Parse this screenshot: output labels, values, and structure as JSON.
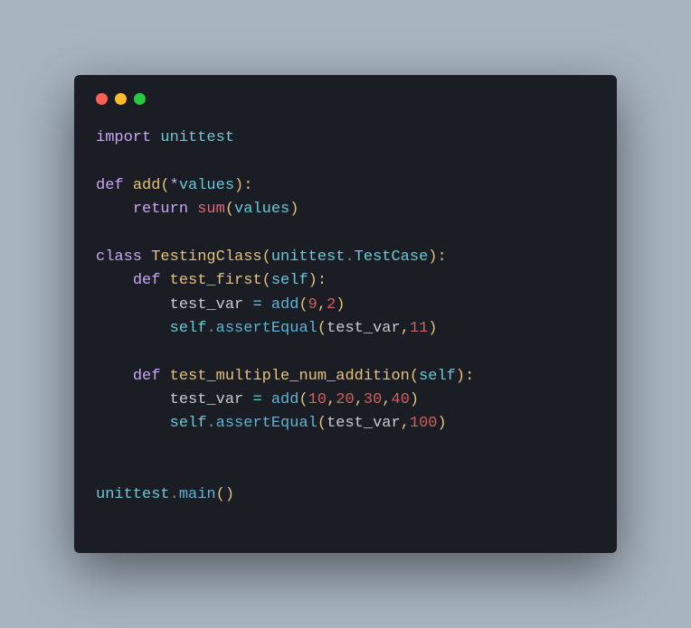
{
  "window": {
    "controls": [
      "close",
      "minimize",
      "zoom"
    ]
  },
  "code": {
    "lines": [
      [
        {
          "t": "import ",
          "c": "kw"
        },
        {
          "t": "unittest",
          "c": "mod"
        }
      ],
      [],
      [
        {
          "t": "def ",
          "c": "kw"
        },
        {
          "t": "add",
          "c": "fnname"
        },
        {
          "t": "(",
          "c": "punct"
        },
        {
          "t": "*",
          "c": "kw"
        },
        {
          "t": "values",
          "c": "param"
        },
        {
          "t": "):",
          "c": "punct"
        }
      ],
      [
        {
          "t": "    ",
          "c": ""
        },
        {
          "t": "return ",
          "c": "kw"
        },
        {
          "t": "sum",
          "c": "builtin"
        },
        {
          "t": "(",
          "c": "punct"
        },
        {
          "t": "values",
          "c": "param"
        },
        {
          "t": ")",
          "c": "punct"
        }
      ],
      [],
      [
        {
          "t": "class ",
          "c": "kw"
        },
        {
          "t": "TestingClass",
          "c": "fnname"
        },
        {
          "t": "(",
          "c": "punct"
        },
        {
          "t": "unittest",
          "c": "mod"
        },
        {
          "t": ".",
          "c": "dot2"
        },
        {
          "t": "TestCase",
          "c": "mod"
        },
        {
          "t": "):",
          "c": "punct"
        }
      ],
      [
        {
          "t": "    ",
          "c": ""
        },
        {
          "t": "def ",
          "c": "kw"
        },
        {
          "t": "test_first",
          "c": "fnname"
        },
        {
          "t": "(",
          "c": "punct"
        },
        {
          "t": "self",
          "c": "param"
        },
        {
          "t": "):",
          "c": "punct"
        }
      ],
      [
        {
          "t": "        ",
          "c": ""
        },
        {
          "t": "test_var",
          "c": "id"
        },
        {
          "t": " = ",
          "c": "op"
        },
        {
          "t": "add",
          "c": "fn"
        },
        {
          "t": "(",
          "c": "punct"
        },
        {
          "t": "9",
          "c": "num"
        },
        {
          "t": ",",
          "c": "punct"
        },
        {
          "t": "2",
          "c": "num"
        },
        {
          "t": ")",
          "c": "punct"
        }
      ],
      [
        {
          "t": "        ",
          "c": ""
        },
        {
          "t": "self",
          "c": "param"
        },
        {
          "t": ".",
          "c": "dot2"
        },
        {
          "t": "assertEqual",
          "c": "fn"
        },
        {
          "t": "(",
          "c": "punct"
        },
        {
          "t": "test_var",
          "c": "id"
        },
        {
          "t": ",",
          "c": "punct"
        },
        {
          "t": "11",
          "c": "num"
        },
        {
          "t": ")",
          "c": "punct"
        }
      ],
      [],
      [
        {
          "t": "    ",
          "c": ""
        },
        {
          "t": "def ",
          "c": "kw"
        },
        {
          "t": "test_multiple_num_addition",
          "c": "fnname"
        },
        {
          "t": "(",
          "c": "punct"
        },
        {
          "t": "self",
          "c": "param"
        },
        {
          "t": "):",
          "c": "punct"
        }
      ],
      [
        {
          "t": "        ",
          "c": ""
        },
        {
          "t": "test_var",
          "c": "id"
        },
        {
          "t": " = ",
          "c": "op"
        },
        {
          "t": "add",
          "c": "fn"
        },
        {
          "t": "(",
          "c": "punct"
        },
        {
          "t": "10",
          "c": "num"
        },
        {
          "t": ",",
          "c": "punct"
        },
        {
          "t": "20",
          "c": "num"
        },
        {
          "t": ",",
          "c": "punct"
        },
        {
          "t": "30",
          "c": "num"
        },
        {
          "t": ",",
          "c": "punct"
        },
        {
          "t": "40",
          "c": "num"
        },
        {
          "t": ")",
          "c": "punct"
        }
      ],
      [
        {
          "t": "        ",
          "c": ""
        },
        {
          "t": "self",
          "c": "param"
        },
        {
          "t": ".",
          "c": "dot2"
        },
        {
          "t": "assertEqual",
          "c": "fn"
        },
        {
          "t": "(",
          "c": "punct"
        },
        {
          "t": "test_var",
          "c": "id"
        },
        {
          "t": ",",
          "c": "punct"
        },
        {
          "t": "100",
          "c": "num"
        },
        {
          "t": ")",
          "c": "punct"
        }
      ],
      [],
      [],
      [
        {
          "t": "unittest",
          "c": "mod"
        },
        {
          "t": ".",
          "c": "dot2"
        },
        {
          "t": "main",
          "c": "fn"
        },
        {
          "t": "()",
          "c": "punct"
        }
      ]
    ]
  }
}
